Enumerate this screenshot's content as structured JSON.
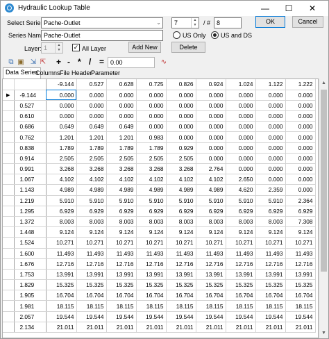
{
  "window": {
    "title": "Hydraulic Lookup Table",
    "min_glyph": "—",
    "max_glyph": "☐",
    "close_glyph": "✕"
  },
  "form": {
    "select_series_label": "Select Series:",
    "select_series_value": "Pache-Outlet",
    "index_value": "7",
    "of_label": "/ #",
    "total_value": "8",
    "series_name_label": "Series Name:",
    "series_name_value": "Pache-Outlet",
    "us_only_label": "US Only",
    "us_and_ds_label": "US and DS",
    "layer_label": "Layer:",
    "layer_value": "1",
    "all_layer_label": "All Layer",
    "ok_label": "OK",
    "cancel_label": "Cancel",
    "add_new_label": "Add New",
    "delete_label": "Delete"
  },
  "toolbar": {
    "ops": [
      "+",
      "-",
      "*",
      "/",
      "="
    ],
    "value": "0.00"
  },
  "tabs": [
    "Data Series",
    "Columns",
    "File Header",
    "Parameter"
  ],
  "table": {
    "columns": [
      "-9.144",
      "0.527",
      "0.628",
      "0.725",
      "0.826",
      "0.924",
      "1.024",
      "1.122",
      "1.222"
    ],
    "rows": [
      {
        "h": "-9.144",
        "v": [
          "0.000",
          "0.000",
          "0.000",
          "0.000",
          "0.000",
          "0.000",
          "0.000",
          "0.000",
          "0.000"
        ]
      },
      {
        "h": "0.527",
        "v": [
          "0.000",
          "0.000",
          "0.000",
          "0.000",
          "0.000",
          "0.000",
          "0.000",
          "0.000",
          "0.000"
        ]
      },
      {
        "h": "0.610",
        "v": [
          "0.000",
          "0.000",
          "0.000",
          "0.000",
          "0.000",
          "0.000",
          "0.000",
          "0.000",
          "0.000"
        ]
      },
      {
        "h": "0.686",
        "v": [
          "0.649",
          "0.649",
          "0.649",
          "0.000",
          "0.000",
          "0.000",
          "0.000",
          "0.000",
          "0.000"
        ]
      },
      {
        "h": "0.762",
        "v": [
          "1.201",
          "1.201",
          "1.201",
          "0.983",
          "0.000",
          "0.000",
          "0.000",
          "0.000",
          "0.000"
        ]
      },
      {
        "h": "0.838",
        "v": [
          "1.789",
          "1.789",
          "1.789",
          "1.789",
          "0.929",
          "0.000",
          "0.000",
          "0.000",
          "0.000"
        ]
      },
      {
        "h": "0.914",
        "v": [
          "2.505",
          "2.505",
          "2.505",
          "2.505",
          "2.505",
          "0.000",
          "0.000",
          "0.000",
          "0.000"
        ]
      },
      {
        "h": "0.991",
        "v": [
          "3.268",
          "3.268",
          "3.268",
          "3.268",
          "3.268",
          "2.764",
          "0.000",
          "0.000",
          "0.000"
        ]
      },
      {
        "h": "1.067",
        "v": [
          "4.102",
          "4.102",
          "4.102",
          "4.102",
          "4.102",
          "4.102",
          "2.650",
          "0.000",
          "0.000"
        ]
      },
      {
        "h": "1.143",
        "v": [
          "4.989",
          "4.989",
          "4.989",
          "4.989",
          "4.989",
          "4.989",
          "4.620",
          "2.359",
          "0.000"
        ]
      },
      {
        "h": "1.219",
        "v": [
          "5.910",
          "5.910",
          "5.910",
          "5.910",
          "5.910",
          "5.910",
          "5.910",
          "5.910",
          "2.364"
        ]
      },
      {
        "h": "1.295",
        "v": [
          "6.929",
          "6.929",
          "6.929",
          "6.929",
          "6.929",
          "6.929",
          "6.929",
          "6.929",
          "6.929"
        ]
      },
      {
        "h": "1.372",
        "v": [
          "8.003",
          "8.003",
          "8.003",
          "8.003",
          "8.003",
          "8.003",
          "8.003",
          "8.003",
          "7.308"
        ]
      },
      {
        "h": "1.448",
        "v": [
          "9.124",
          "9.124",
          "9.124",
          "9.124",
          "9.124",
          "9.124",
          "9.124",
          "9.124",
          "9.124"
        ]
      },
      {
        "h": "1.524",
        "v": [
          "10.271",
          "10.271",
          "10.271",
          "10.271",
          "10.271",
          "10.271",
          "10.271",
          "10.271",
          "10.271"
        ]
      },
      {
        "h": "1.600",
        "v": [
          "11.493",
          "11.493",
          "11.493",
          "11.493",
          "11.493",
          "11.493",
          "11.493",
          "11.493",
          "11.493"
        ]
      },
      {
        "h": "1.676",
        "v": [
          "12.716",
          "12.716",
          "12.716",
          "12.716",
          "12.716",
          "12.716",
          "12.716",
          "12.716",
          "12.716"
        ]
      },
      {
        "h": "1.753",
        "v": [
          "13.991",
          "13.991",
          "13.991",
          "13.991",
          "13.991",
          "13.991",
          "13.991",
          "13.991",
          "13.991"
        ]
      },
      {
        "h": "1.829",
        "v": [
          "15.325",
          "15.325",
          "15.325",
          "15.325",
          "15.325",
          "15.325",
          "15.325",
          "15.325",
          "15.325"
        ]
      },
      {
        "h": "1.905",
        "v": [
          "16.704",
          "16.704",
          "16.704",
          "16.704",
          "16.704",
          "16.704",
          "16.704",
          "16.704",
          "16.704"
        ]
      },
      {
        "h": "1.981",
        "v": [
          "18.115",
          "18.115",
          "18.115",
          "18.115",
          "18.115",
          "18.115",
          "18.115",
          "18.115",
          "18.115"
        ]
      },
      {
        "h": "2.057",
        "v": [
          "19.544",
          "19.544",
          "19.544",
          "19.544",
          "19.544",
          "19.544",
          "19.544",
          "19.544",
          "19.544"
        ]
      },
      {
        "h": "2.134",
        "v": [
          "21.011",
          "21.011",
          "21.011",
          "21.011",
          "21.011",
          "21.011",
          "21.011",
          "21.011",
          "21.011"
        ]
      }
    ]
  }
}
